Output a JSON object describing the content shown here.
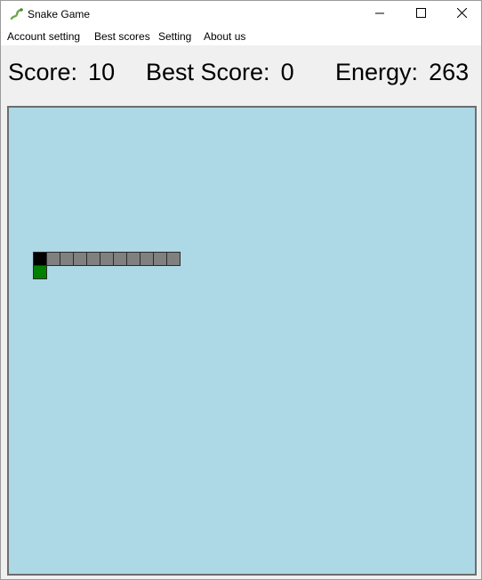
{
  "window": {
    "title": "Snake Game",
    "icon": "snake-icon",
    "controls": [
      "minimize-icon",
      "maximize-icon",
      "close-icon"
    ]
  },
  "menu": {
    "items": [
      "Account setting",
      "Best scores",
      "Setting",
      "About us"
    ]
  },
  "stats": {
    "score_label": "Score:",
    "score_value": "10",
    "best_label": "Best Score:",
    "best_value": "0",
    "energy_label": "Energy:",
    "energy_value": "263"
  },
  "board": {
    "background_color": "#add8e6",
    "head_color": "#000000",
    "body_color": "#808080",
    "food_color": "#008000",
    "snake_body_length": 10,
    "direction": "left"
  }
}
